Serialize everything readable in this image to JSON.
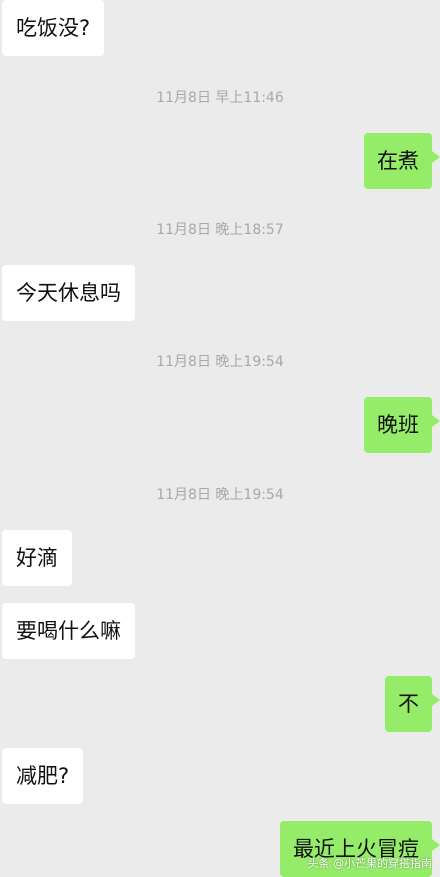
{
  "messages": [
    {
      "side": "left",
      "text": "吃饭没?"
    },
    {
      "side": "timestamp",
      "text": "11月8日 早上11:46"
    },
    {
      "side": "right",
      "text": "在煮"
    },
    {
      "side": "timestamp",
      "text": "11月8日 晚上18:57"
    },
    {
      "side": "left",
      "text": "今天休息吗"
    },
    {
      "side": "timestamp",
      "text": "11月8日 晚上19:54"
    },
    {
      "side": "right",
      "text": "晚班"
    },
    {
      "side": "timestamp",
      "text": "11月8日 晚上19:54"
    },
    {
      "side": "left",
      "text": "好滴"
    },
    {
      "side": "left",
      "text": "要喝什么嘛"
    },
    {
      "side": "right",
      "text": "不"
    },
    {
      "side": "left",
      "text": "减肥?"
    },
    {
      "side": "right",
      "text": "最近上火冒痘"
    }
  ],
  "watermark": "头条 @小芒果的穿搭指南",
  "colors": {
    "background": "#ebebeb",
    "left_bubble": "#ffffff",
    "right_bubble": "#95ec69",
    "timestamp_text": "#a8a8a8"
  }
}
